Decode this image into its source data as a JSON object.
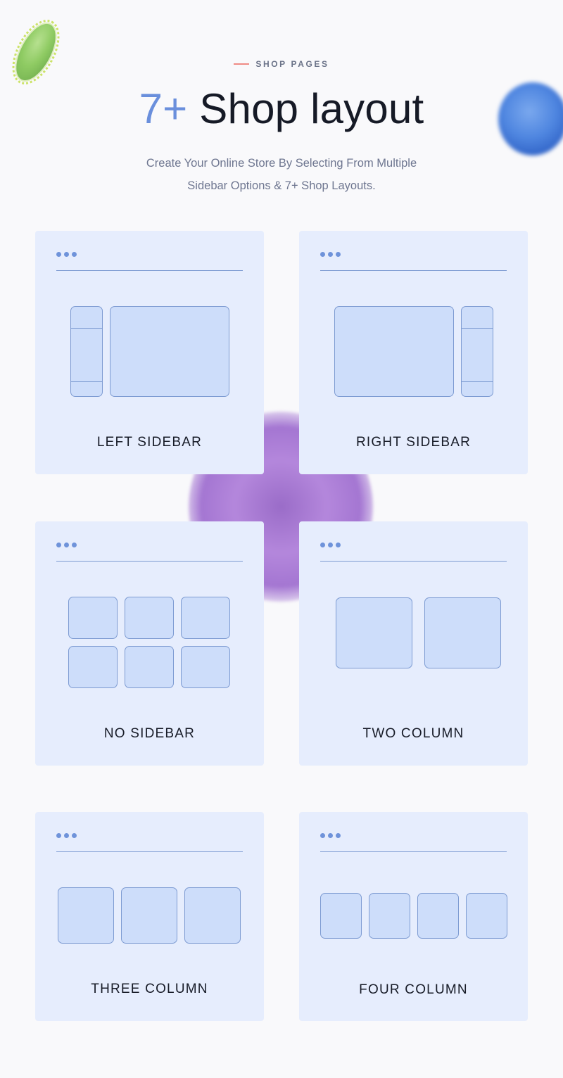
{
  "header": {
    "eyebrow": "SHOP PAGES",
    "title_accent": "7+",
    "title_rest": "Shop layout",
    "subtitle_line1": "Create Your Online Store By Selecting From Multiple",
    "subtitle_line2": "Sidebar Options & 7+ Shop Layouts."
  },
  "colors": {
    "accent": "#6a8fdc",
    "eyebrow_line": "#ef8b85",
    "card_bg": "#e6edfd",
    "box_fill": "#cdddfa",
    "box_border": "#7d9bd2",
    "heading": "#161a26",
    "muted_text": "#6e7690"
  },
  "decorations": [
    "green-bacteria-icon",
    "blue-virus-icon",
    "purple-virus-icon"
  ],
  "layouts": [
    {
      "id": "left-sidebar",
      "label": "LEFT SIDEBAR"
    },
    {
      "id": "right-sidebar",
      "label": "RIGHT SIDEBAR"
    },
    {
      "id": "no-sidebar",
      "label": "NO SIDEBAR"
    },
    {
      "id": "two-column",
      "label": "TWO COLUMN"
    },
    {
      "id": "three-column",
      "label": "THREE COLUMN"
    },
    {
      "id": "four-column",
      "label": "FOUR COLUMN"
    }
  ]
}
